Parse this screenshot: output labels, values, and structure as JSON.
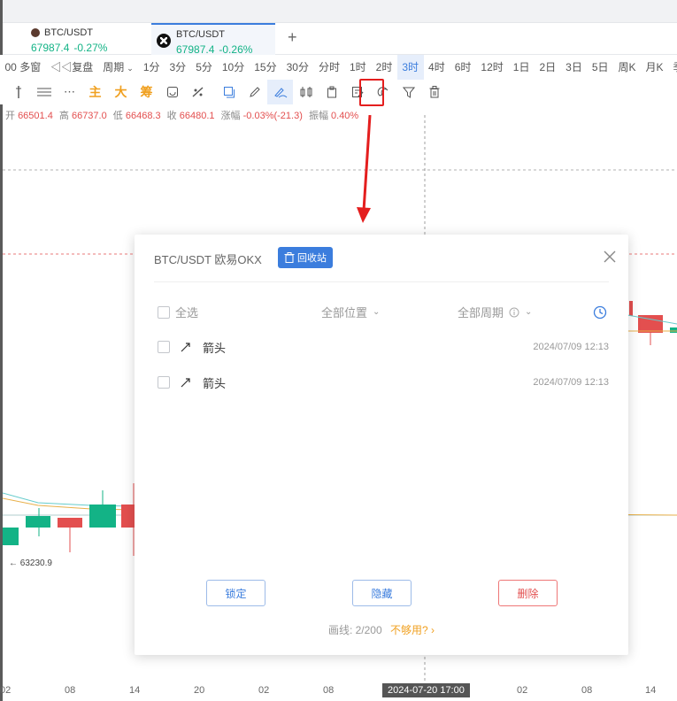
{
  "tabs": [
    {
      "symbol": "BTC/USDT",
      "price": "67987.4",
      "change": "-0.27%"
    },
    {
      "symbol": "BTC/USDT",
      "price": "67987.4",
      "change": "-0.26%"
    }
  ],
  "periods": {
    "multi_window": "多窗",
    "replay": "复盘",
    "period_menu": "周期",
    "items": [
      "1分",
      "3分",
      "5分",
      "10分",
      "15分",
      "30分",
      "分时",
      "1时",
      "2时",
      "3时",
      "4时",
      "6时",
      "12时",
      "1日",
      "2日",
      "3日",
      "5日",
      "周K",
      "月K",
      "季K"
    ],
    "active": "3时",
    "prefix_glyph": "00"
  },
  "toolbar": {
    "main": "主",
    "big": "大",
    "chip": "筹"
  },
  "ohlc": {
    "open_label": "开",
    "open": "66501.4",
    "high_label": "高",
    "high": "66737.0",
    "low_label": "低",
    "low": "66468.3",
    "close_label": "收",
    "close": "66480.1",
    "change_label": "涨幅",
    "change": "-0.03%(-21.3)",
    "amp_label": "振幅",
    "amp": "0.40%"
  },
  "chart": {
    "price_tag": "← 63230.9",
    "x_labels": [
      "02",
      "08",
      "14",
      "20",
      "02",
      "08",
      "2024-07-20 17:00",
      "02",
      "08",
      "14"
    ]
  },
  "modal": {
    "title": "BTC/USDT 欧易OKX",
    "recycle_label": "回收站",
    "select_all": "全选",
    "all_positions": "全部位置",
    "all_periods": "全部周期",
    "rows": [
      {
        "name": "箭头",
        "time": "2024/07/09 12:13"
      },
      {
        "name": "箭头",
        "time": "2024/07/09 12:13"
      }
    ],
    "lock_label": "锁定",
    "hide_label": "隐藏",
    "delete_label": "删除",
    "count_label": "画线: 2/200",
    "not_enough": "不够用?"
  },
  "colors": {
    "up": "#13b386",
    "down": "#e34f4f",
    "accent": "#3b7ddd",
    "highlight": "#e41e1e"
  }
}
